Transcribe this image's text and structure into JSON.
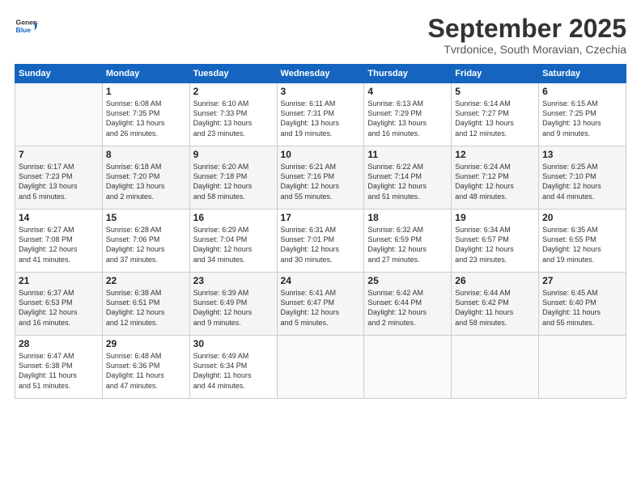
{
  "header": {
    "logo_line1": "General",
    "logo_line2": "Blue",
    "month_title": "September 2025",
    "subtitle": "Tvrdonice, South Moravian, Czechia"
  },
  "weekdays": [
    "Sunday",
    "Monday",
    "Tuesday",
    "Wednesday",
    "Thursday",
    "Friday",
    "Saturday"
  ],
  "weeks": [
    [
      {
        "day": "",
        "info": ""
      },
      {
        "day": "1",
        "info": "Sunrise: 6:08 AM\nSunset: 7:35 PM\nDaylight: 13 hours\nand 26 minutes."
      },
      {
        "day": "2",
        "info": "Sunrise: 6:10 AM\nSunset: 7:33 PM\nDaylight: 13 hours\nand 23 minutes."
      },
      {
        "day": "3",
        "info": "Sunrise: 6:11 AM\nSunset: 7:31 PM\nDaylight: 13 hours\nand 19 minutes."
      },
      {
        "day": "4",
        "info": "Sunrise: 6:13 AM\nSunset: 7:29 PM\nDaylight: 13 hours\nand 16 minutes."
      },
      {
        "day": "5",
        "info": "Sunrise: 6:14 AM\nSunset: 7:27 PM\nDaylight: 13 hours\nand 12 minutes."
      },
      {
        "day": "6",
        "info": "Sunrise: 6:15 AM\nSunset: 7:25 PM\nDaylight: 13 hours\nand 9 minutes."
      }
    ],
    [
      {
        "day": "7",
        "info": "Sunrise: 6:17 AM\nSunset: 7:23 PM\nDaylight: 13 hours\nand 5 minutes."
      },
      {
        "day": "8",
        "info": "Sunrise: 6:18 AM\nSunset: 7:20 PM\nDaylight: 13 hours\nand 2 minutes."
      },
      {
        "day": "9",
        "info": "Sunrise: 6:20 AM\nSunset: 7:18 PM\nDaylight: 12 hours\nand 58 minutes."
      },
      {
        "day": "10",
        "info": "Sunrise: 6:21 AM\nSunset: 7:16 PM\nDaylight: 12 hours\nand 55 minutes."
      },
      {
        "day": "11",
        "info": "Sunrise: 6:22 AM\nSunset: 7:14 PM\nDaylight: 12 hours\nand 51 minutes."
      },
      {
        "day": "12",
        "info": "Sunrise: 6:24 AM\nSunset: 7:12 PM\nDaylight: 12 hours\nand 48 minutes."
      },
      {
        "day": "13",
        "info": "Sunrise: 6:25 AM\nSunset: 7:10 PM\nDaylight: 12 hours\nand 44 minutes."
      }
    ],
    [
      {
        "day": "14",
        "info": "Sunrise: 6:27 AM\nSunset: 7:08 PM\nDaylight: 12 hours\nand 41 minutes."
      },
      {
        "day": "15",
        "info": "Sunrise: 6:28 AM\nSunset: 7:06 PM\nDaylight: 12 hours\nand 37 minutes."
      },
      {
        "day": "16",
        "info": "Sunrise: 6:29 AM\nSunset: 7:04 PM\nDaylight: 12 hours\nand 34 minutes."
      },
      {
        "day": "17",
        "info": "Sunrise: 6:31 AM\nSunset: 7:01 PM\nDaylight: 12 hours\nand 30 minutes."
      },
      {
        "day": "18",
        "info": "Sunrise: 6:32 AM\nSunset: 6:59 PM\nDaylight: 12 hours\nand 27 minutes."
      },
      {
        "day": "19",
        "info": "Sunrise: 6:34 AM\nSunset: 6:57 PM\nDaylight: 12 hours\nand 23 minutes."
      },
      {
        "day": "20",
        "info": "Sunrise: 6:35 AM\nSunset: 6:55 PM\nDaylight: 12 hours\nand 19 minutes."
      }
    ],
    [
      {
        "day": "21",
        "info": "Sunrise: 6:37 AM\nSunset: 6:53 PM\nDaylight: 12 hours\nand 16 minutes."
      },
      {
        "day": "22",
        "info": "Sunrise: 6:38 AM\nSunset: 6:51 PM\nDaylight: 12 hours\nand 12 minutes."
      },
      {
        "day": "23",
        "info": "Sunrise: 6:39 AM\nSunset: 6:49 PM\nDaylight: 12 hours\nand 9 minutes."
      },
      {
        "day": "24",
        "info": "Sunrise: 6:41 AM\nSunset: 6:47 PM\nDaylight: 12 hours\nand 5 minutes."
      },
      {
        "day": "25",
        "info": "Sunrise: 6:42 AM\nSunset: 6:44 PM\nDaylight: 12 hours\nand 2 minutes."
      },
      {
        "day": "26",
        "info": "Sunrise: 6:44 AM\nSunset: 6:42 PM\nDaylight: 11 hours\nand 58 minutes."
      },
      {
        "day": "27",
        "info": "Sunrise: 6:45 AM\nSunset: 6:40 PM\nDaylight: 11 hours\nand 55 minutes."
      }
    ],
    [
      {
        "day": "28",
        "info": "Sunrise: 6:47 AM\nSunset: 6:38 PM\nDaylight: 11 hours\nand 51 minutes."
      },
      {
        "day": "29",
        "info": "Sunrise: 6:48 AM\nSunset: 6:36 PM\nDaylight: 11 hours\nand 47 minutes."
      },
      {
        "day": "30",
        "info": "Sunrise: 6:49 AM\nSunset: 6:34 PM\nDaylight: 11 hours\nand 44 minutes."
      },
      {
        "day": "",
        "info": ""
      },
      {
        "day": "",
        "info": ""
      },
      {
        "day": "",
        "info": ""
      },
      {
        "day": "",
        "info": ""
      }
    ]
  ]
}
